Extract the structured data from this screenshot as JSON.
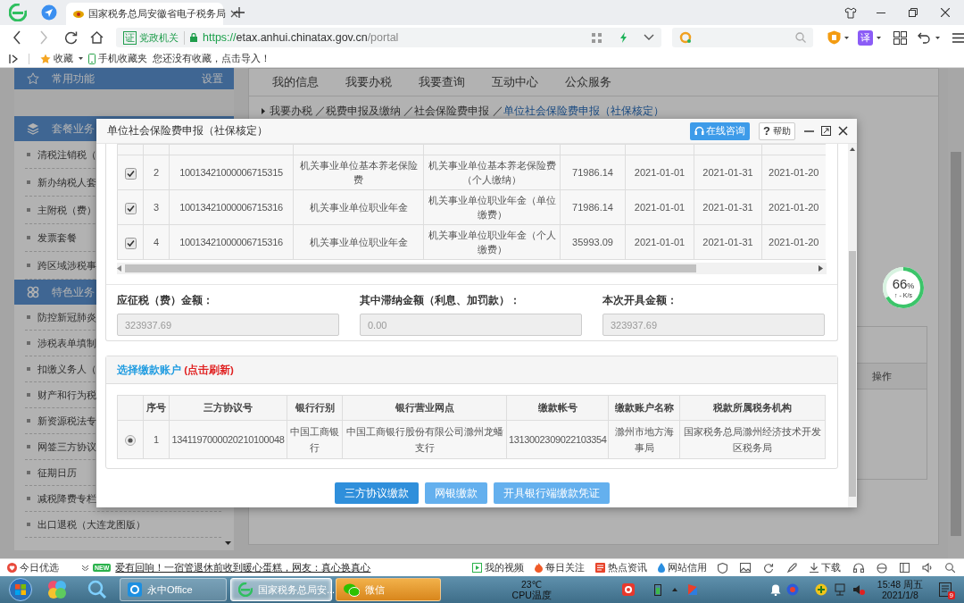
{
  "browser": {
    "tab_title": "国家税务总局安徽省电子税务局",
    "badge_mark": "证",
    "gov_badge": "党政机关",
    "url": {
      "scheme": "https://",
      "host": "etax.anhui.chinatax.gov.cn",
      "path": "/portal"
    },
    "translate_mark": "译",
    "bookmarks": [
      {
        "kind": "star",
        "label": "收藏"
      },
      {
        "kind": "phone",
        "label": "手机收藏夹"
      },
      {
        "kind": "text",
        "label": "您还没有收藏，点击导入！"
      }
    ]
  },
  "sidebar": {
    "sections": [
      {
        "kind": "star",
        "title": "常用功能",
        "action": "设置"
      },
      {
        "kind": "layers",
        "title": "套餐业务",
        "items": [
          "清税注销税（",
          "新办纳税人套",
          "主附税（费）",
          "发票套餐",
          "跨区域涉税事"
        ]
      },
      {
        "kind": "clover",
        "title": "特色业务",
        "items": [
          "防控新冠肺炎",
          "涉税表单填制",
          "扣缴义务人（",
          "财产和行为税",
          "新资源税法专",
          "网签三方协议",
          "征期日历",
          "减税降费专栏",
          "出口退税（大连龙图版）"
        ]
      }
    ]
  },
  "nav_tabs": [
    "我的信息",
    "我要办税",
    "我要查询",
    "互动中心",
    "公众服务"
  ],
  "breadcrumb": {
    "path": "我要办税 ／税费申报及缴纳 ／社会保险费申报 ／",
    "current": "单位社会保险费申报（社保核定）"
  },
  "background_table": {
    "column": "操作"
  },
  "speed_widget": {
    "percent": "66",
    "unit": "%",
    "rate": "↑ - K/s",
    "level": 0.66
  },
  "dialog": {
    "title": "单位社会保险费申报（社保核定）",
    "consult_button": "在线咨询",
    "help_icon": "?",
    "help_button": "帮助",
    "items_table": {
      "rows": [
        {
          "checked": true,
          "cells": [
            "2",
            "10013421000006715315",
            "机关事业单位基本养老保险费",
            "机关事业单位基本养老保险费（个人缴纳）",
            "71986.14",
            "2021-01-01",
            "2021-01-31",
            "2021-01-20"
          ]
        },
        {
          "checked": true,
          "cells": [
            "3",
            "10013421000006715316",
            "机关事业单位职业年金",
            "机关事业单位职业年金（单位缴费）",
            "71986.14",
            "2021-01-01",
            "2021-01-31",
            "2021-01-20"
          ]
        },
        {
          "checked": true,
          "cells": [
            "4",
            "10013421000006715316",
            "机关事业单位职业年金",
            "机关事业单位职业年金（个人缴费）",
            "35993.09",
            "2021-01-01",
            "2021-01-31",
            "2021-01-20"
          ]
        }
      ]
    },
    "amounts": [
      {
        "label": "应征税（费）金额：",
        "value": "323937.69"
      },
      {
        "label": "其中滞纳金额（利息、加罚款）：",
        "value": "0.00"
      },
      {
        "label": "本次开具金额：",
        "value": "323937.69"
      }
    ],
    "accounts": {
      "title": "选择缴款账户",
      "refresh": "(点击刷新)",
      "columns": [
        "序号",
        "三方协议号",
        "银行行别",
        "银行营业网点",
        "缴款帐号",
        "缴款账户名称",
        "税款所属税务机构"
      ],
      "rows": [
        {
          "selected": true,
          "cells": [
            "1",
            "1341197000020210100048",
            "中国工商银行",
            "中国工商银行股份有限公司滁州龙蟠支行",
            "1313002309022103354",
            "滁州市地方海事局",
            "国家税务总局滁州经济技术开发区税务局"
          ]
        }
      ]
    },
    "buttons": [
      {
        "label": "三方协议缴款",
        "disabled": false
      },
      {
        "label": "网银缴款",
        "disabled": true
      },
      {
        "label": "开具银行端缴款凭证",
        "disabled": true
      }
    ]
  },
  "status_bar": {
    "left": "今日优选",
    "news_badge": "NEW",
    "headline": "爱有回响！一宿管退休前收到暖心蛋糕，网友：真心换真心",
    "links": [
      "我的视频",
      "每日关注",
      "热点资讯",
      "网站信用"
    ],
    "download": "下载"
  },
  "taskbar": {
    "windows": [
      {
        "label": "永中Office",
        "selected": false,
        "flashing": false
      },
      {
        "label": "国家税务总局安...",
        "selected": true,
        "flashing": false
      },
      {
        "label": "微信",
        "selected": false,
        "flashing": true
      }
    ],
    "temperature": "23℃",
    "temperature_label": "CPU温度",
    "time": "15:48 周五",
    "date": "2021/1/8",
    "notification_count": "9"
  }
}
